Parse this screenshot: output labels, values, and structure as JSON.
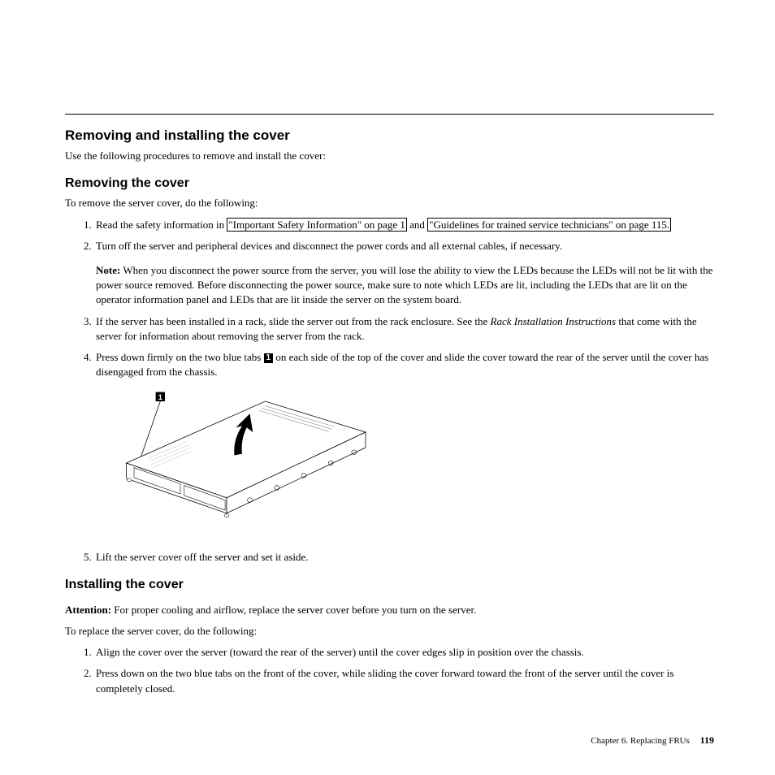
{
  "section1": {
    "heading": "Removing and installing the cover",
    "intro": "Use the following procedures to remove and install the cover:"
  },
  "section2": {
    "heading": "Removing the cover",
    "intro": "To remove the server cover, do the following:",
    "step1_pre": "Read the safety information in ",
    "step1_link1": "\"Important Safety Information\" on page 1",
    "step1_mid": " and ",
    "step1_link2": "\"Guidelines for trained service technicians\" on page 115.",
    "step2": "Turn off the server and peripheral devices and disconnect the power cords and all external cables, if necessary.",
    "note_label": "Note:",
    "note_body": " When you disconnect the power source from the server, you will lose the ability to view the LEDs because the LEDs will not be lit with the power source removed. Before disconnecting the power source, make sure to note which LEDs are lit, including the LEDs that are lit on the operator information panel and LEDs that are lit inside the server on the system board.",
    "step3_pre": "If the server has been installed in a rack, slide the server out from the rack enclosure. See the ",
    "step3_italic": "Rack Installation Instructions",
    "step3_post": " that come with the server for information about removing the server from the rack.",
    "step4_pre": "Press down firmly on the two blue tabs ",
    "step4_callout": "1",
    "step4_post": " on each side of the top of the cover and slide the cover toward the rear of the server until the cover has disengaged from the chassis.",
    "fig_callout": "1",
    "step5": "Lift the server cover off the server and set it aside."
  },
  "section3": {
    "heading": "Installing the cover",
    "attention_label": "Attention:",
    "attention_body": " For proper cooling and airflow, replace the server cover before you turn on the server.",
    "intro": "To replace the server cover, do the following:",
    "step1": "Align the cover over the server (toward the rear of the server) until the cover edges slip in position over the chassis.",
    "step2": "Press down on the two blue tabs on the front of the cover, while sliding the cover forward toward the front of the server until the cover is completely closed."
  },
  "footer": {
    "chapter": "Chapter 6. Replacing FRUs",
    "page": "119"
  }
}
